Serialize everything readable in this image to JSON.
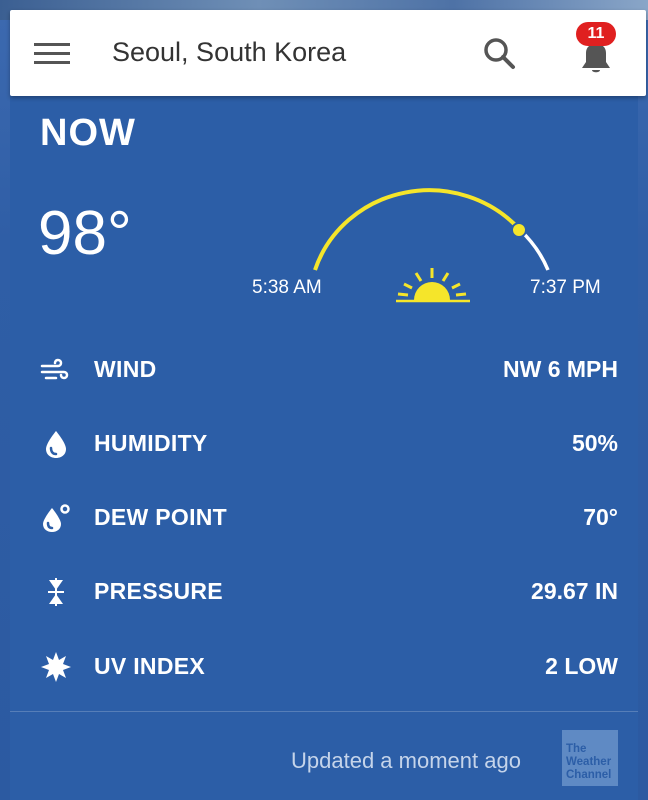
{
  "header": {
    "location": "Seoul, South Korea",
    "notification_count": "11"
  },
  "now": {
    "label": "NOW",
    "temperature": "98°",
    "sunrise": "5:38 AM",
    "sunset": "7:37 PM"
  },
  "conditions": [
    {
      "label": "WIND",
      "value": "NW 6 MPH",
      "icon": "wind-icon"
    },
    {
      "label": "HUMIDITY",
      "value": "50%",
      "icon": "droplet-icon"
    },
    {
      "label": "DEW POINT",
      "value": "70°",
      "icon": "dew-point-icon"
    },
    {
      "label": "PRESSURE",
      "value": "29.67 IN",
      "icon": "pressure-icon"
    },
    {
      "label": "UV INDEX",
      "value": "2 LOW",
      "icon": "uv-sun-icon"
    }
  ],
  "footer": {
    "updated": "Updated a moment ago",
    "logo_text": "The Weather Channel"
  },
  "colors": {
    "card_bg": "#2c5ea7",
    "sun_yellow": "#f5e52a",
    "badge_red": "#e02020"
  }
}
